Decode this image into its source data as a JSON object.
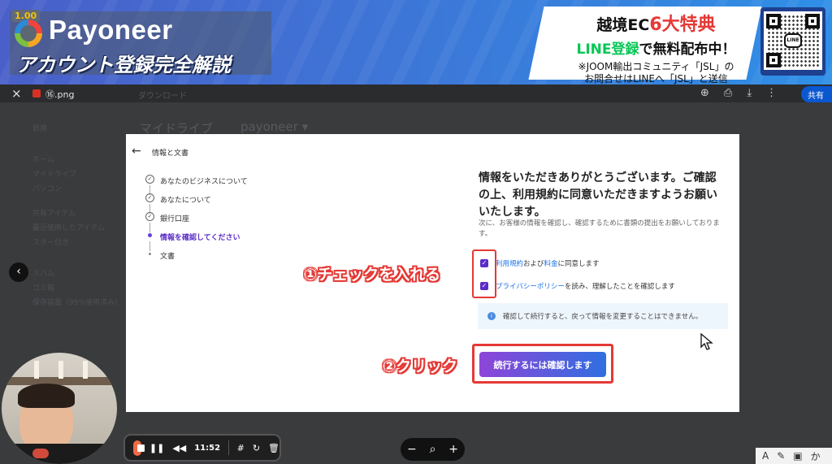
{
  "banner": {
    "version": "1.00",
    "brand": "Payoneer",
    "subtitle": "アカウント登録完全解説",
    "promo_line1_prefix": "越境EC",
    "promo_line1_highlight": "6大特典",
    "promo_line2_green": "LINE登録",
    "promo_line2_rest": "で無料配布中！",
    "promo_line3": "※JOOM輸出コミュニティ「JSL」の",
    "promo_line4": "お問合せはLINEへ「JSL」と送信",
    "qr_badge": "LINE"
  },
  "viewer": {
    "close_icon": "×",
    "filename": "⑯.png",
    "faded_label": "ダウンロード",
    "share_label": "共有"
  },
  "drive_bg": {
    "path_1": "マイドライブ",
    "path_2": "payoneer ▾",
    "new_label": "新規",
    "nav": [
      "ホーム",
      "マイドライブ",
      "パソコン",
      "共有アイテム",
      "最近使用したアイテム",
      "スター付き",
      "スパム",
      "ゴミ箱",
      "保存容量（99%使用済み）"
    ]
  },
  "dialog": {
    "back_icon": "←",
    "title": "情報と文書",
    "steps": [
      {
        "label": "あなたのビジネスについて",
        "state": "done"
      },
      {
        "label": "あなたについて",
        "state": "done"
      },
      {
        "label": "銀行口座",
        "state": "done"
      },
      {
        "label": "情報を確認してください",
        "state": "active"
      },
      {
        "label": "文書",
        "state": "pending"
      }
    ],
    "heading": "情報をいただきありがとうございます。ご確認の上、利用規約に同意いただきますようお願いいたします。",
    "subtext": "次に、お客様の情報を確認し、確認するために書類の提出をお願いしております。",
    "checkbox1": {
      "link1": "利用規約",
      "mid": "および",
      "link2": "料金",
      "tail": "に同意します",
      "checked": true
    },
    "checkbox2": {
      "link": "プライバシーポリシー",
      "tail": "を読み、理解したことを確認します",
      "checked": true
    },
    "info_icon": "i",
    "info_text": "確認して続行すると、戻って情報を変更することはできません。",
    "confirm_button": "続行するには確認します"
  },
  "annotations": {
    "step1": "①チェックを入れる",
    "step2": "②クリック",
    "color": "#e53935"
  },
  "recorder": {
    "time": "11:52",
    "pause_icon": "❚❚",
    "rewind_icon": "◀◀",
    "grid_icon": "#",
    "reset_icon": "↻",
    "trash_icon": "🗑"
  },
  "zoom": {
    "minus": "−",
    "search": "⌕",
    "plus": "+"
  },
  "tools": {
    "text_icon": "A",
    "pen_icon": "✎",
    "cam_icon": "▣",
    "truncated": "か"
  },
  "side_arrow_icon": "‹"
}
